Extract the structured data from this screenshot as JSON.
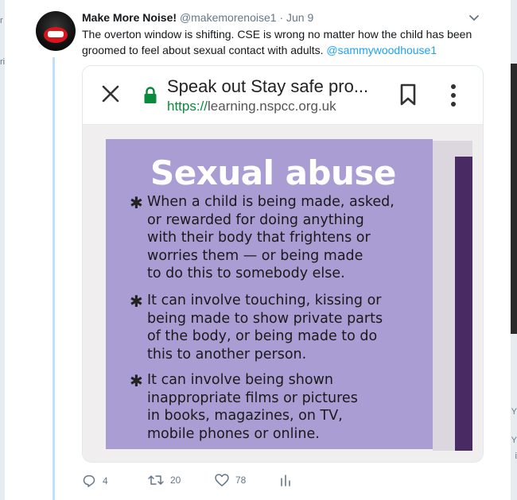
{
  "tweet": {
    "display_name": "Make More Noise!",
    "handle": "@makemorenoise1",
    "separator": "·",
    "date": "Jun 9",
    "text": "The overton window is shifting. CSE is wrong no matter how the child has been groomed to feel about sexual contact with adults.",
    "mention": "@sammywoodhouse1"
  },
  "card": {
    "browser_title": "Speak out Stay safe pro...",
    "url_scheme": "https://",
    "url_host": "learning.nspcc.org.uk",
    "panel": {
      "title": "Sexual abuse",
      "bullet_glyph": "✱",
      "items": [
        [
          "When a child is being made, asked,",
          "or rewarded for doing anything",
          "with their body that frightens or",
          "worries them — or being made",
          "to do this to somebody else."
        ],
        [
          "It can involve touching, kissing or",
          "being made to show private parts",
          "of the body, or being made to do",
          "this to another person."
        ],
        [
          "It can involve being shown",
          "inappropriate films or pictures",
          "in books, magazines, on TV,",
          "mobile phones or online."
        ]
      ]
    }
  },
  "actions": {
    "replies": "4",
    "retweets": "20",
    "likes": "78"
  },
  "background": {
    "left_fragments": [
      "r",
      "ri"
    ],
    "right_fragments": [
      "Y",
      "Y",
      "i"
    ]
  },
  "colors": {
    "accent": "#1da1f2",
    "thread_line": "#bfe0f8",
    "panel_purple": "#a99dd3",
    "secure_green": "#0a8a3c"
  },
  "icons": {
    "caret": "chevron-down-icon",
    "close": "close-icon",
    "lock": "lock-icon",
    "bookmark": "bookmark-icon",
    "menu": "more-vertical-icon",
    "reply": "reply-icon",
    "retweet": "retweet-icon",
    "like": "heart-icon",
    "analytics": "analytics-icon"
  }
}
